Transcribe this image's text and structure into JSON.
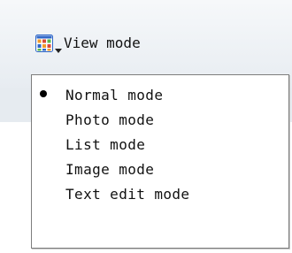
{
  "toolbar": {
    "view_mode_label": "View mode",
    "view_mode_icon": "grid-icon",
    "dropdown_icon": "chevron-down-icon"
  },
  "menu": {
    "selected_index": 0,
    "items": [
      {
        "label": "Normal mode",
        "checked": true
      },
      {
        "label": "Photo mode",
        "checked": false
      },
      {
        "label": "List mode",
        "checked": false
      },
      {
        "label": "Image mode",
        "checked": false
      },
      {
        "label": "Text edit mode",
        "checked": false
      }
    ]
  },
  "colors": {
    "toolbar_bg": "#e7ecf1",
    "menu_border": "#7d7d7d",
    "icon_blue": "#2f67c8",
    "icon_orange": "#f09a2a",
    "icon_red": "#d84a3b",
    "icon_green": "#59b84b"
  }
}
